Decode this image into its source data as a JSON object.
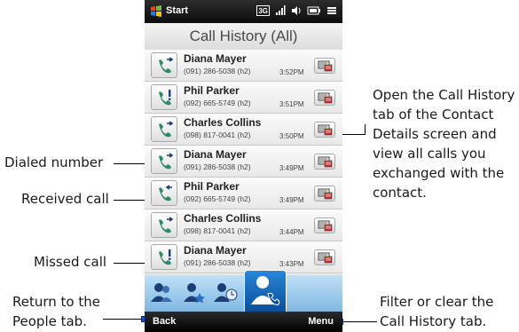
{
  "status_bar": {
    "start_label": "Start",
    "network_badge": "3G"
  },
  "screen_title": "Call History (All)",
  "calls": [
    {
      "type": "dialed",
      "name": "Diana Mayer",
      "number": "(091) 286-5038 (h2)",
      "time": "3:52PM"
    },
    {
      "type": "missed",
      "name": "Phil Parker",
      "number": "(092) 665-5749 (h2)",
      "time": "3:51PM"
    },
    {
      "type": "dialed",
      "name": "Charles Collins",
      "number": "(098) 817-0041 (h2)",
      "time": "3:50PM"
    },
    {
      "type": "dialed",
      "name": "Diana Mayer",
      "number": "(091) 286-5038 (h2)",
      "time": "3:49PM"
    },
    {
      "type": "received",
      "name": "Phil Parker",
      "number": "(092) 665-5749 (h2)",
      "time": "3:49PM"
    },
    {
      "type": "dialed",
      "name": "Charles Collins",
      "number": "(098) 817-0041 (h2)",
      "time": "3:44PM"
    },
    {
      "type": "missed",
      "name": "Diana Mayer",
      "number": "(091) 286-5038 (h2)",
      "time": "3:43PM"
    }
  ],
  "softkeys": {
    "left": "Back",
    "right": "Menu"
  },
  "annotations": {
    "dialed": "Dialed number",
    "received": "Received call",
    "missed": "Missed call",
    "return_line1": "Return to the",
    "return_line2": "People tab.",
    "contact_line1": "Open the Call History",
    "contact_line2": "tab of the Contact",
    "contact_line3": "Details screen and",
    "contact_line4": "view all calls you",
    "contact_line5": "exchanged with the",
    "contact_line6": "contact.",
    "filter_line1": "Filter or clear the",
    "filter_line2": "Call History tab."
  },
  "colors": {
    "accent_blue": "#1b4fbf",
    "tab_active": "#0a4e9a",
    "missed_red": "#2e7d5b"
  }
}
